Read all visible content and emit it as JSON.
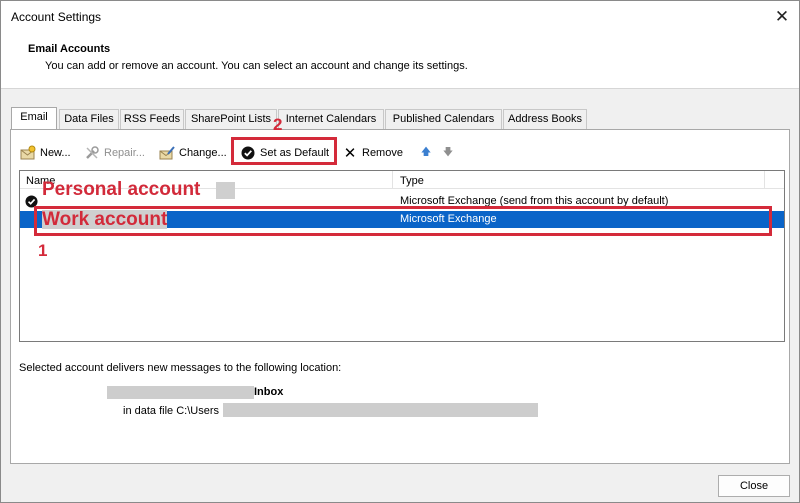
{
  "window": {
    "title": "Account Settings",
    "close_glyph": "✕"
  },
  "header": {
    "title": "Email Accounts",
    "description": "You can add or remove an account. You can select an account and change its settings."
  },
  "tabs": [
    {
      "label": "Email",
      "active": true
    },
    {
      "label": "Data Files"
    },
    {
      "label": "RSS Feeds"
    },
    {
      "label": "SharePoint Lists"
    },
    {
      "label": "Internet Calendars"
    },
    {
      "label": "Published Calendars"
    },
    {
      "label": "Address Books"
    }
  ],
  "toolbar": {
    "new_label": "New...",
    "repair_label": "Repair...",
    "change_label": "Change...",
    "set_default_label": "Set as Default",
    "remove_label": "Remove",
    "remove_glyph": "✕",
    "move_up_glyph": "🡅",
    "move_down_glyph": "🡇"
  },
  "list": {
    "column_name": "Name",
    "column_type": "Type",
    "rows": [
      {
        "name": "Personal account",
        "type": "Microsoft Exchange (send from this account by default)",
        "default": true,
        "selected": false
      },
      {
        "name": "Work account",
        "type": "Microsoft Exchange",
        "default": false,
        "selected": true
      }
    ]
  },
  "delivery": {
    "label": "Selected account delivers new messages to the following location:",
    "inbox_label": "Inbox",
    "data_file_label": "in data file C:\\Users"
  },
  "buttons": {
    "close_label": "Close"
  },
  "annotations": {
    "label_1": "1",
    "label_2": "2",
    "color": "#d42a3a"
  },
  "colors": {
    "selection": "#0a64c8",
    "annotation": "#d42a3a"
  }
}
